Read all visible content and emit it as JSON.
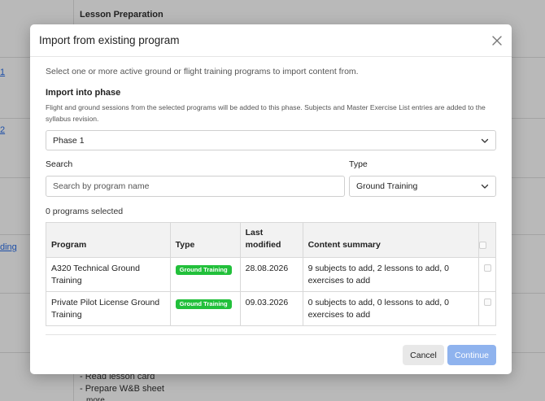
{
  "background": {
    "title": "Lesson Preparation",
    "links": [
      "1",
      "2",
      "ding"
    ],
    "bottom_items": [
      "- Read lesson card",
      "- Prepare W&B sheet",
      "more"
    ]
  },
  "modal": {
    "title": "Import from existing program",
    "intro": "Select one or more active ground or flight training programs to import content from.",
    "phase": {
      "label": "Import into phase",
      "help": "Flight and ground sessions from the selected programs will be added to this phase. Subjects and Master Exercise List entries are added to the syllabus revision.",
      "selected": "Phase 1"
    },
    "search": {
      "label": "Search",
      "placeholder": "Search by program name",
      "value": ""
    },
    "type": {
      "label": "Type",
      "selected": "Ground Training"
    },
    "selected_count": "0 programs selected",
    "table": {
      "headers": [
        "Program",
        "Type",
        "Last modified",
        "Content summary"
      ],
      "rows": [
        {
          "program": "A320 Technical Ground Training",
          "type": "Ground Training",
          "last_modified": "28.08.2026",
          "summary": "9 subjects to add, 2 lessons to add, 0 exercises to add"
        },
        {
          "program": "Private Pilot License Ground Training",
          "type": "Ground Training",
          "last_modified": "09.03.2026",
          "summary": "0 subjects to add, 0 lessons to add, 0 exercises to add"
        }
      ]
    },
    "buttons": {
      "cancel": "Cancel",
      "continue": "Continue"
    }
  },
  "colors": {
    "badge": "#22c03b",
    "primary_disabled": "#8fb3ee",
    "link": "#1d4fa8"
  },
  "icons": {
    "close": "close-icon",
    "chevron": "chevron-down-icon"
  }
}
